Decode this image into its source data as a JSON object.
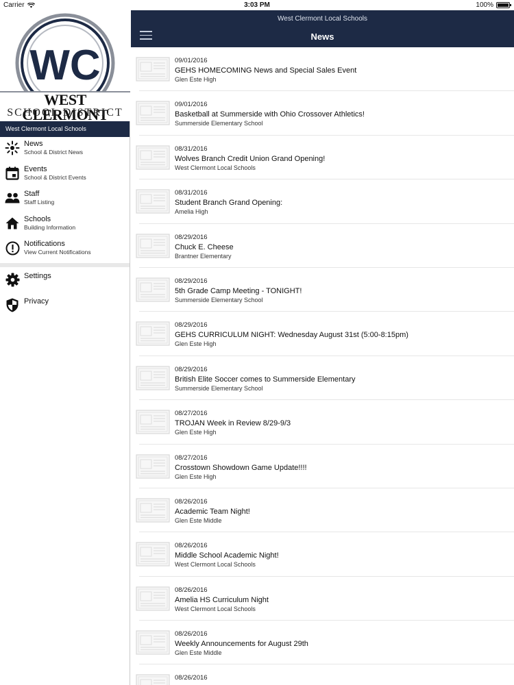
{
  "status_bar": {
    "carrier": "Carrier",
    "time": "3:03 PM",
    "battery": "100%",
    "battery_level": 1.0
  },
  "sidebar": {
    "logo_initials": "WC",
    "logo_name_line1": "WEST CLERMONT",
    "logo_name_line2": "SCHOOL DISTRICT",
    "header": "West Clermont Local Schools",
    "items": [
      {
        "label": "News",
        "sub": "School & District News",
        "icon": "sun-icon"
      },
      {
        "label": "Events",
        "sub": "School & District Events",
        "icon": "calendar-icon"
      },
      {
        "label": "Staff",
        "sub": "Staff Listing",
        "icon": "people-icon"
      },
      {
        "label": "Schools",
        "sub": "Building Information",
        "icon": "home-icon"
      },
      {
        "label": "Notifications",
        "sub": "View Current Notifications",
        "icon": "alert-icon"
      }
    ],
    "secondary": [
      {
        "label": "Settings",
        "icon": "gear-icon"
      },
      {
        "label": "Privacy",
        "icon": "shield-icon"
      }
    ]
  },
  "navbar": {
    "subtitle": "West Clermont Local Schools",
    "title": "News"
  },
  "news": [
    {
      "date": "09/01/2016",
      "title": "GEHS HOMECOMING News and Special Sales Event",
      "school": "Glen Este High"
    },
    {
      "date": "09/01/2016",
      "title": "Basketball at Summerside with Ohio Crossover Athletics!",
      "school": "Summerside Elementary School"
    },
    {
      "date": "08/31/2016",
      "title": "Wolves Branch Credit Union Grand Opening!",
      "school": "West Clermont Local Schools"
    },
    {
      "date": "08/31/2016",
      "title": "Student Branch Grand Opening:",
      "school": "Amelia High"
    },
    {
      "date": "08/29/2016",
      "title": "Chuck E. Cheese",
      "school": "Brantner Elementary"
    },
    {
      "date": "08/29/2016",
      "title": "5th Grade Camp Meeting - TONIGHT!",
      "school": "Summerside Elementary School"
    },
    {
      "date": "08/29/2016",
      "title": "GEHS CURRICULUM NIGHT: Wednesday August 31st (5:00-8:15pm)",
      "school": "Glen Este High"
    },
    {
      "date": "08/29/2016",
      "title": "British Elite Soccer comes to Summerside Elementary",
      "school": "Summerside Elementary School"
    },
    {
      "date": "08/27/2016",
      "title": "TROJAN  Week in Review   8/29-9/3",
      "school": "Glen Este High"
    },
    {
      "date": "08/27/2016",
      "title": "Crosstown Showdown Game Update!!!!",
      "school": "Glen Este High"
    },
    {
      "date": "08/26/2016",
      "title": "Academic Team Night!",
      "school": "Glen Este Middle"
    },
    {
      "date": "08/26/2016",
      "title": "Middle School Academic Night!",
      "school": "West Clermont Local Schools"
    },
    {
      "date": "08/26/2016",
      "title": "Amelia HS Curriculum Night",
      "school": "West Clermont Local Schools"
    },
    {
      "date": "08/26/2016",
      "title": "Weekly Announcements for August 29th",
      "school": "Glen Este Middle"
    },
    {
      "date": "08/26/2016",
      "title": "",
      "school": ""
    }
  ],
  "colors": {
    "navy": "#1d2a45",
    "logo_ring": "#8a8f99"
  }
}
